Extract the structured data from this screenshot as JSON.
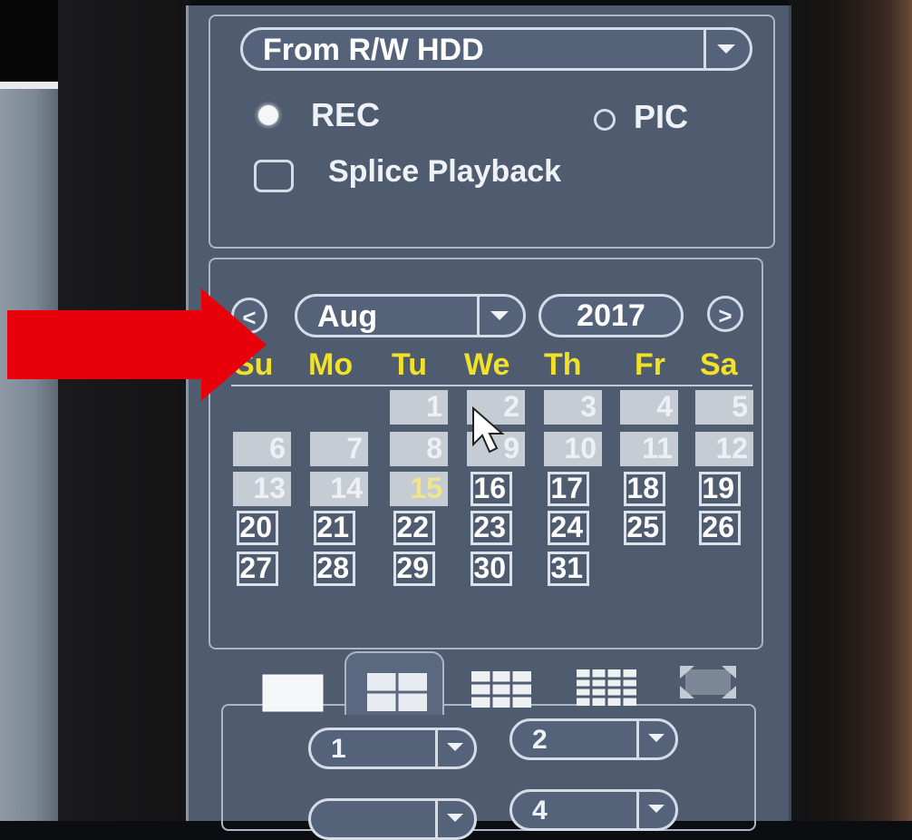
{
  "source": {
    "selected": "From R/W HDD"
  },
  "mode": {
    "rec_label": "REC",
    "pic_label": "PIC",
    "selected": "REC"
  },
  "splice": {
    "label": "Splice Playback",
    "checked": false
  },
  "calendar": {
    "prev": "<",
    "next": ">",
    "month": "Aug",
    "year": "2017",
    "weekdays": [
      "Su",
      "Mo",
      "Tu",
      "We",
      "Th",
      "Fr",
      "Sa"
    ],
    "today": "15",
    "recorded_days": [
      "1",
      "2",
      "3",
      "4",
      "5",
      "6",
      "7",
      "8",
      "9",
      "10",
      "11",
      "12",
      "13",
      "14",
      "15"
    ],
    "days": [
      "1",
      "2",
      "3",
      "4",
      "5",
      "6",
      "7",
      "8",
      "9",
      "10",
      "11",
      "12",
      "13",
      "14",
      "15",
      "16",
      "17",
      "18",
      "19",
      "20",
      "21",
      "22",
      "23",
      "24",
      "25",
      "26",
      "27",
      "28",
      "29",
      "30",
      "31"
    ]
  },
  "view_modes": [
    "single",
    "quad",
    "9-split",
    "16-split",
    "fullscreen"
  ],
  "active_view": "quad",
  "channels": [
    "1",
    "2",
    "",
    "4"
  ],
  "colors": {
    "panel": "#4f5b6e",
    "weekday": "#f2e12a",
    "annotation_arrow": "#e8000b"
  }
}
